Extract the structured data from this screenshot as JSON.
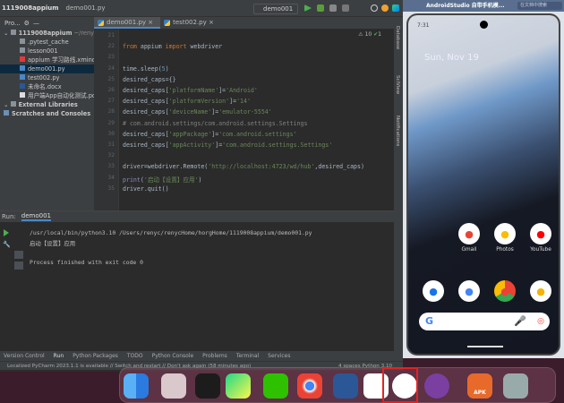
{
  "navbar": {
    "project": "1119008appium",
    "file": "demo001.py",
    "run_config": "demo001"
  },
  "project_panel": {
    "title": "Pro...",
    "items": [
      {
        "label": "1119008appium",
        "suffix": "~/renycHo",
        "type": "folder",
        "depth": 0
      },
      {
        "label": ".pytest_cache",
        "type": "folder",
        "depth": 1
      },
      {
        "label": "lesson001",
        "type": "folder",
        "depth": 1
      },
      {
        "label": "appium 学习路线.xmind",
        "type": "xmind",
        "depth": 1
      },
      {
        "label": "demo001.py",
        "type": "python",
        "depth": 1,
        "selected": true
      },
      {
        "label": "test002.py",
        "type": "python",
        "depth": 1
      },
      {
        "label": "未命名.docx",
        "type": "docx",
        "depth": 1
      },
      {
        "label": "用户端App自动化测试.pdf",
        "type": "pdf",
        "depth": 1
      },
      {
        "label": "External Libraries",
        "type": "library",
        "depth": 0
      },
      {
        "label": "Scratches and Consoles",
        "type": "scratch",
        "depth": 0
      }
    ]
  },
  "editor": {
    "tabs": [
      "demo001.py",
      "test002.py"
    ],
    "active_tab": "demo001.py",
    "warnings": "10",
    "checks": "1",
    "line_numbers": [
      "21",
      "22",
      "23",
      "24",
      "25",
      "26",
      "27",
      "28",
      "29",
      "30",
      "31",
      "32",
      "33",
      "34",
      "35"
    ],
    "lines": [
      "",
      "from appium import webdriver",
      "",
      "time.sleep(5)",
      "desired_caps={}",
      "desired_caps['platformName']='Android'",
      "desired_caps['platformVersion']='14'",
      "desired_caps['deviceName']='emulator-5554'",
      "# com.android.settings/com.android.settings.Settings",
      "desired_caps['appPackage']='com.android.settings'",
      "desired_caps['appActivity']='com.android.settings.Settings'",
      "",
      "driver=webdriver.Remote('http://localhost:4723/wd/hub',desired_caps)",
      "print('启动【设置】应用')",
      "driver.quit()"
    ]
  },
  "right_strip": [
    "Database",
    "SciView",
    "Notifications"
  ],
  "run_panel": {
    "label": "Run:",
    "tab": "demo001",
    "output": [
      "/usr/local/bin/python3.10 /Users/renyc/renycHome/horgHome/1119008appium/demo001.py",
      "启动【设置】应用",
      "",
      "Process finished with exit code 0"
    ]
  },
  "tool_tabs": [
    "Version Control",
    "Run",
    "Python Packages",
    "TODO",
    "Python Console",
    "Problems",
    "Terminal",
    "Services"
  ],
  "status": {
    "message": "Localized PyCharm 2023.1.1 is available // Switch and restart // Don't ask again (58 minutes ago)",
    "right": "4 spaces   Python 3.10"
  },
  "emulator": {
    "title": "AndroidStudio 自带手机模...",
    "search_placeholder": "在文档中搜索",
    "time": "7:31",
    "date": "Sun, Nov 19",
    "apps_row1": [
      {
        "name": "Gmail",
        "color": "#ea4335"
      },
      {
        "name": "Photos",
        "color": "#fbbc05"
      },
      {
        "name": "YouTube",
        "color": "#ff0000"
      }
    ],
    "apps_row2": [
      "phone",
      "messages",
      "chrome",
      "camera"
    ]
  },
  "dock": [
    "Finder",
    "Launchpad",
    "Terminal",
    "PyCharm",
    "WeChat",
    "Chrome",
    "Word",
    "Android Studio",
    "Device Manager",
    "Unknown",
    "APK",
    "Trash"
  ],
  "colors": {
    "ide_bg": "#2b2b2b",
    "panel": "#3c3f41",
    "accent": "#4a88c7",
    "highlight_box": "#e52222"
  }
}
